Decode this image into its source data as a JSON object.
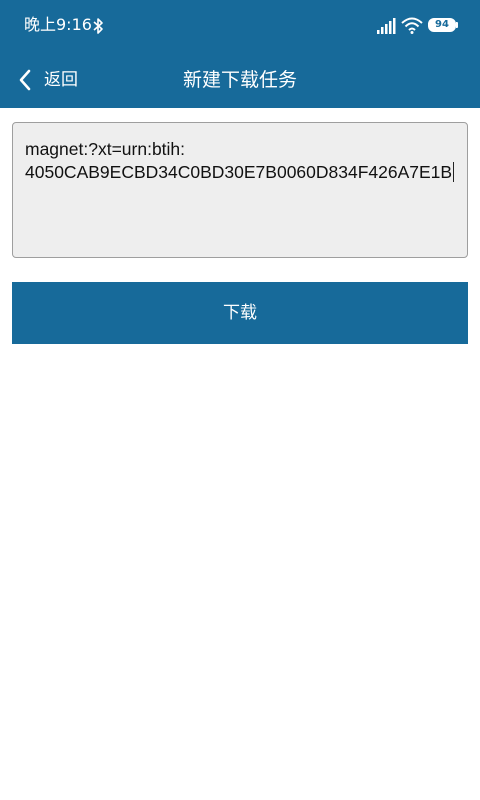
{
  "status_bar": {
    "time": "晚上9:16",
    "battery_level": "94",
    "icons": [
      "bluetooth-icon",
      "signal-icon",
      "wifi-icon",
      "battery-icon"
    ]
  },
  "header": {
    "back_label": "返回",
    "title": "新建下载任务"
  },
  "form": {
    "url_value": "magnet:?xt=urn:btih:\n4050CAB9ECBD34C0BD30E7B0060D834F426A7E1B",
    "download_label": "下载"
  },
  "colors": {
    "primary": "#176a9a",
    "input_background": "#eeeeee",
    "page_background": "#ffffff"
  }
}
